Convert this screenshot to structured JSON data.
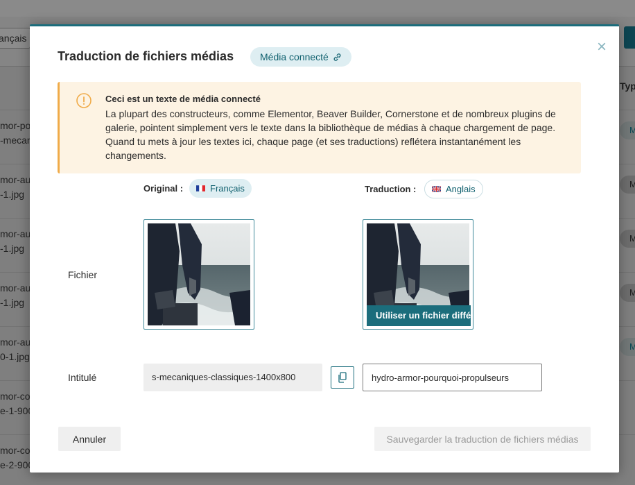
{
  "background": {
    "language_select": "ançais",
    "column_header": "Typ",
    "rows": [
      {
        "line1": "mor-po",
        "line2": "-mecan",
        "badge": "M",
        "badge_accent": true
      },
      {
        "line1": "mor-aut",
        "line2": "-1.jpg",
        "badge": "M",
        "badge_accent": false
      },
      {
        "line1": "mor-aut",
        "line2": "-1.jpg",
        "badge": "M",
        "badge_accent": false
      },
      {
        "line1": "mor-aut",
        "line2": "-1.jpg",
        "badge": "M",
        "badge_accent": false
      },
      {
        "line1": "mor-aut",
        "line2": "0-1.jpg",
        "badge": "M",
        "badge_accent": true
      },
      {
        "line1": "mor-co",
        "line2": "e-1-900",
        "badge": "",
        "badge_accent": false
      },
      {
        "line1": "mor-co",
        "line2": "e-2-900",
        "badge": "",
        "badge_accent": false
      }
    ]
  },
  "modal": {
    "title": "Traduction de fichiers médias",
    "connected_chip": "Média connecté",
    "close_symbol": "×",
    "notice": {
      "title": "Ceci est un texte de média connecté",
      "text": "La plupart des constructeurs, comme Elementor, Beaver Builder, Cornerstone et de nombreux plugins de galerie, pointent simplement vers le texte dans la bibliothèque de médias à chaque chargement de page. Quand tu mets à jour les textes ici, chaque page (et ses traductions) reflétera instantanément les changements."
    },
    "original_label": "Original :",
    "original_language": "Français",
    "translation_label": "Traduction :",
    "translation_language": "Anglais",
    "file_label": "Fichier",
    "use_different_file": "Utiliser un fichier différent",
    "title_label": "Intitulé",
    "original_title_value": "s-mecaniques-classiques-1400x800",
    "translated_title_value": "hydro-armor-pourquoi-propulseurs",
    "cancel_button": "Annuler",
    "save_button": "Sauvegarder la traduction de fichiers médias"
  },
  "colors": {
    "accent": "#1b6d7c",
    "notice_bg": "#fdf3e3",
    "notice_border": "#f0ab49",
    "chip_bg": "#deeef2"
  }
}
